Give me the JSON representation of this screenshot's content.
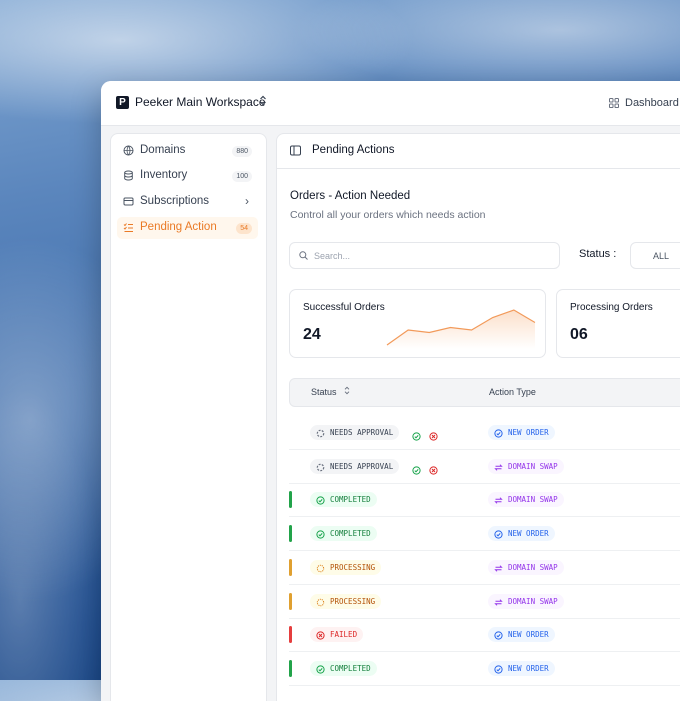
{
  "workspace": {
    "logo_letter": "P",
    "name": "Peeker Main Workspace"
  },
  "header": {
    "dashboard_label": "Dashboard"
  },
  "sidebar": {
    "items": [
      {
        "label": "Domains",
        "icon": "globe-icon",
        "badge": "880"
      },
      {
        "label": "Inventory",
        "icon": "database-icon",
        "badge": "100"
      },
      {
        "label": "Subscriptions",
        "icon": "card-icon",
        "chevron": "›"
      },
      {
        "label": "Pending Action",
        "icon": "list-check-icon",
        "badge": "54",
        "active": true
      }
    ]
  },
  "main": {
    "title": "Pending Actions",
    "section_title": "Orders - Action Needed",
    "section_subtitle": "Control all your orders which needs action",
    "search_placeholder": "Search...",
    "status_label": "Status :",
    "status_value": "ALL",
    "cards": [
      {
        "title": "Successful Orders",
        "value": "24",
        "sparkline": [
          3,
          9,
          8,
          10,
          9,
          14,
          17,
          12
        ]
      },
      {
        "title": "Processing Orders",
        "value": "06"
      }
    ],
    "table": {
      "headers": {
        "status": "Status",
        "action": "Action Type"
      },
      "rows": [
        {
          "status": "NEEDS APPROVAL",
          "kind": "needs",
          "action": "NEW ORDER",
          "akind": "new"
        },
        {
          "status": "NEEDS APPROVAL",
          "kind": "needs",
          "action": "DOMAIN SWAP",
          "akind": "swap"
        },
        {
          "status": "COMPLETED",
          "kind": "completed",
          "action": "DOMAIN SWAP",
          "akind": "swap"
        },
        {
          "status": "COMPLETED",
          "kind": "completed",
          "action": "NEW ORDER",
          "akind": "new"
        },
        {
          "status": "PROCESSING",
          "kind": "processing",
          "action": "DOMAIN SWAP",
          "akind": "swap"
        },
        {
          "status": "PROCESSING",
          "kind": "processing",
          "action": "DOMAIN SWAP",
          "akind": "swap"
        },
        {
          "status": "FAILED",
          "kind": "failed",
          "action": "NEW ORDER",
          "akind": "new"
        },
        {
          "status": "COMPLETED",
          "kind": "completed",
          "action": "NEW ORDER",
          "akind": "new"
        }
      ]
    }
  },
  "colors": {
    "accent": "#ea7a26",
    "completed": "#22a34a",
    "processing": "#e0a030",
    "failed": "#e53e3e",
    "new_order": "#2563eb",
    "domain_swap": "#9333ea"
  }
}
